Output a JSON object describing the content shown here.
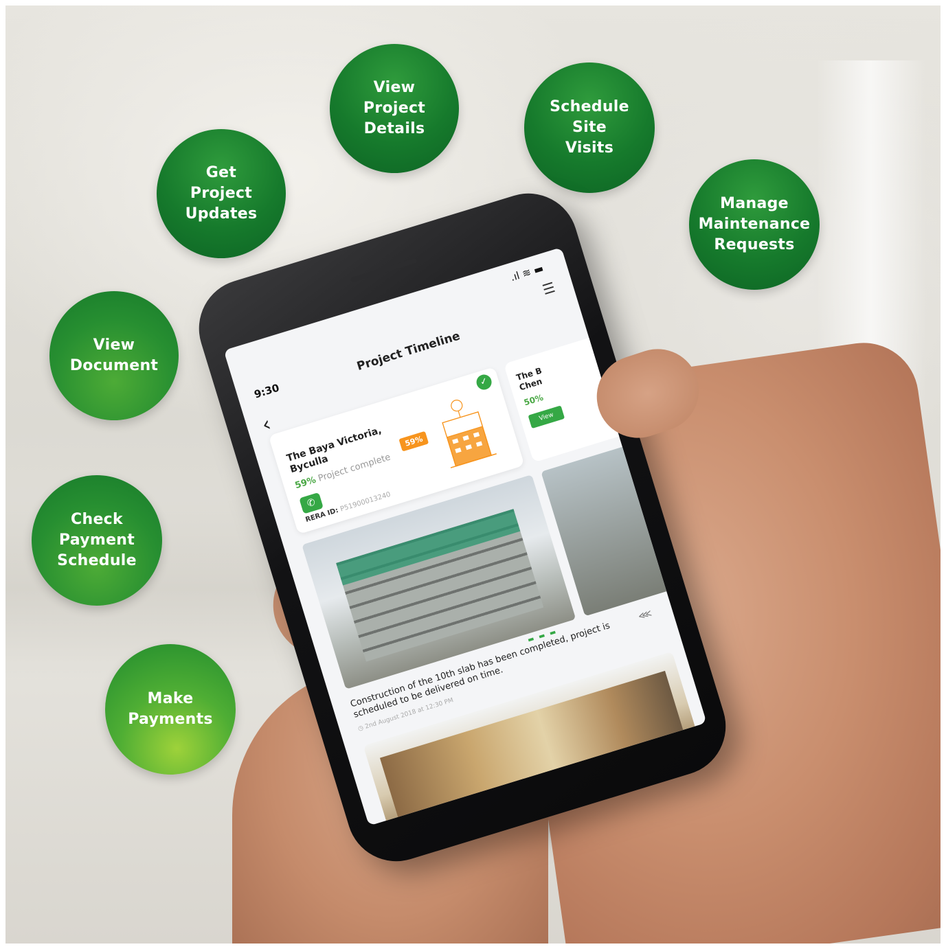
{
  "features": [
    {
      "label": "View\nProject\nDetails"
    },
    {
      "label": "Schedule\nSite\nVisits"
    },
    {
      "label": "Get\nProject\nUpdates"
    },
    {
      "label": "Manage\nMaintenance\nRequests"
    },
    {
      "label": "View\nDocument"
    },
    {
      "label": "Check\nPayment\nSchedule"
    },
    {
      "label": "Make\nPayments"
    }
  ],
  "app": {
    "status_time": "9:30",
    "status_icons": ".ıl ≋ ▬",
    "title": "Project Timeline",
    "back_icon": "chevron-left-icon",
    "menu_icon": "menu-icon",
    "project_card": {
      "name": "The Baya Victoria, Byculla",
      "progress_value": "59%",
      "progress_text": "Project complete",
      "badge": "59%",
      "rera_label": "RERA ID:",
      "rera_id": "P51900013240"
    },
    "next_card": {
      "name": "The B\nChen",
      "progress_value": "50%",
      "button": "View"
    },
    "update": {
      "caption": "Construction of the 10th slab has been completed, project is scheduled to be delivered on time.",
      "date": "2nd August 2018 at 12:30 PM"
    }
  },
  "colors": {
    "accent_green": "#35a845",
    "dark_green": "#0d6424",
    "orange": "#f7941d"
  }
}
